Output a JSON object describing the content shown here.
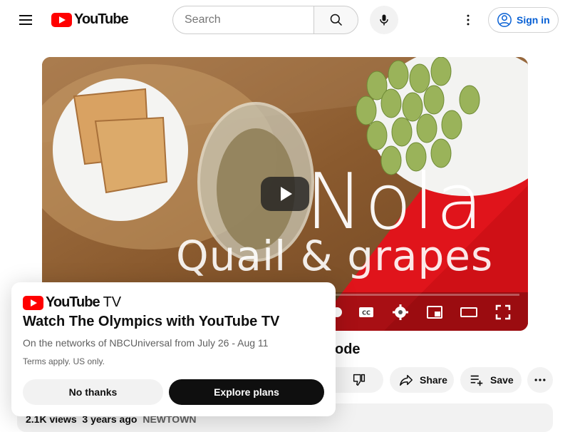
{
  "masthead": {
    "logo_text": "YouTube",
    "search_placeholder": "Search",
    "signin_label": "Sign in"
  },
  "video": {
    "overlay_title": "Nola",
    "overlay_subtitle": "Quail & grapes",
    "title_visible": "ode",
    "actions": {
      "share": "Share",
      "save": "Save"
    },
    "description": {
      "views": "2.1K views",
      "age": "3 years ago",
      "channel": "NEWTOWN"
    }
  },
  "promo": {
    "logo_text": "YouTube",
    "logo_suffix": "TV",
    "title": "Watch The Olympics with YouTube TV",
    "subtitle": "On the networks of NBCUniversal from July 26 - Aug 11",
    "terms": "Terms apply. US only.",
    "no_thanks": "No thanks",
    "explore": "Explore plans"
  },
  "colors": {
    "brand_red": "#ff0000",
    "link_blue": "#065fd4",
    "chip_bg": "#f2f2f2"
  }
}
